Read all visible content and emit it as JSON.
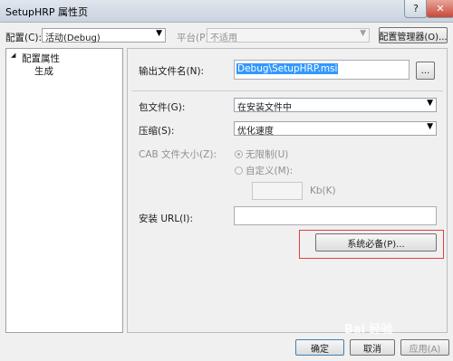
{
  "window": {
    "title": "SetupHRP 属性页",
    "help_label": "?",
    "close_label": "✕"
  },
  "config_row": {
    "config_label": "配置(C):",
    "config_value": "活动(Debug)",
    "platform_label": "平台(P):",
    "platform_value": "不适用",
    "config_manager_label": "配置管理器(O)..."
  },
  "tree": {
    "root_label": "配置属性",
    "root_expander": "◢",
    "child_label": "生成"
  },
  "form": {
    "output_label": "输出文件名(N):",
    "output_value": "Debug\\SetupHRP.msi",
    "browse_label": "...",
    "package_label": "包文件(G):",
    "package_value": "在安装文件中",
    "compress_label": "压缩(S):",
    "compress_value": "优化速度",
    "cab_label": "CAB 文件大小(Z):",
    "unlimited_label": "无限制(U)",
    "custom_label": "自定义(M):",
    "kb_label": "Kb(K)",
    "url_label": "安装 URL(I):",
    "prereq_label": "系统必备(P)..."
  },
  "footer": {
    "ok_label": "确定",
    "cancel_label": "取消",
    "apply_label": "应用(A)"
  },
  "watermark": {
    "text": "Bai 经验"
  },
  "colors": {
    "highlight": "#3399ff",
    "annotation_box": "#e04040"
  }
}
